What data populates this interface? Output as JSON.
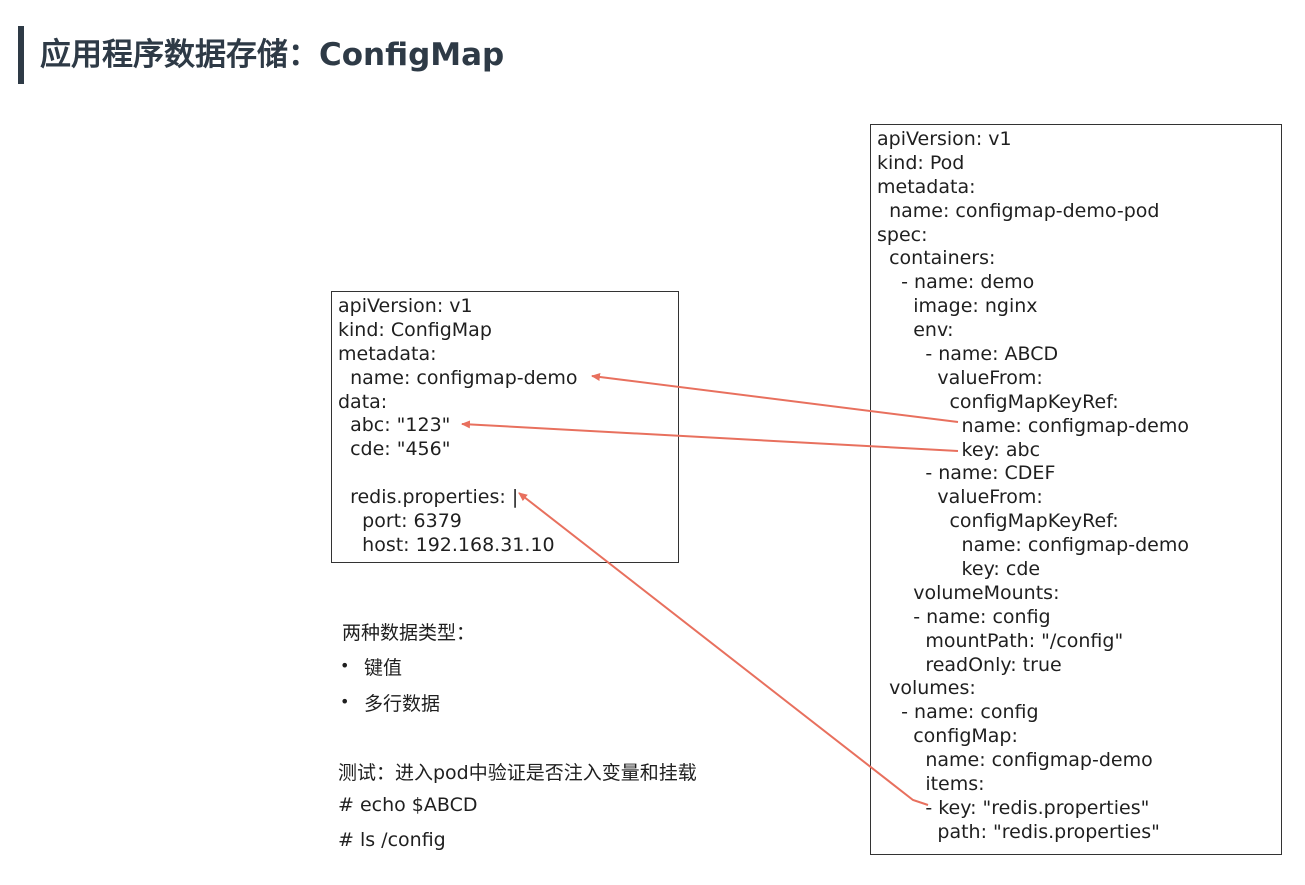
{
  "title": "应用程序数据存储：ConfigMap",
  "configmap_yaml": [
    "apiVersion: v1",
    "kind: ConfigMap",
    "metadata:",
    "  name: configmap-demo",
    "data:",
    "  abc: \"123\"",
    "  cde: \"456\"",
    "",
    "  redis.properties: |",
    "    port: 6379",
    "    host: 192.168.31.10"
  ],
  "pod_yaml": [
    "apiVersion: v1",
    "kind: Pod",
    "metadata:",
    "  name: configmap-demo-pod",
    "spec:",
    "  containers:",
    "    - name: demo",
    "      image: nginx",
    "      env:",
    "        - name: ABCD",
    "          valueFrom:",
    "            configMapKeyRef:",
    "              name: configmap-demo",
    "              key: abc",
    "        - name: CDEF",
    "          valueFrom:",
    "            configMapKeyRef:",
    "              name: configmap-demo",
    "              key: cde",
    "      volumeMounts:",
    "      - name: config",
    "        mountPath: \"/config\"",
    "        readOnly: true",
    "  volumes:",
    "    - name: config",
    "      configMap:",
    "        name: configmap-demo",
    "        items:",
    "        - key: \"redis.properties\"",
    "          path: \"redis.properties\""
  ],
  "notes": {
    "types_heading": "两种数据类型：",
    "bullet_glyph": "•",
    "types": [
      "键值",
      "多行数据"
    ],
    "test_heading": "测试：进入pod中验证是否注入变量和挂载",
    "commands": [
      "# echo $ABCD",
      "# ls /config"
    ]
  },
  "colors": {
    "arrow": "#e8705e",
    "title": "#2e3a46"
  }
}
